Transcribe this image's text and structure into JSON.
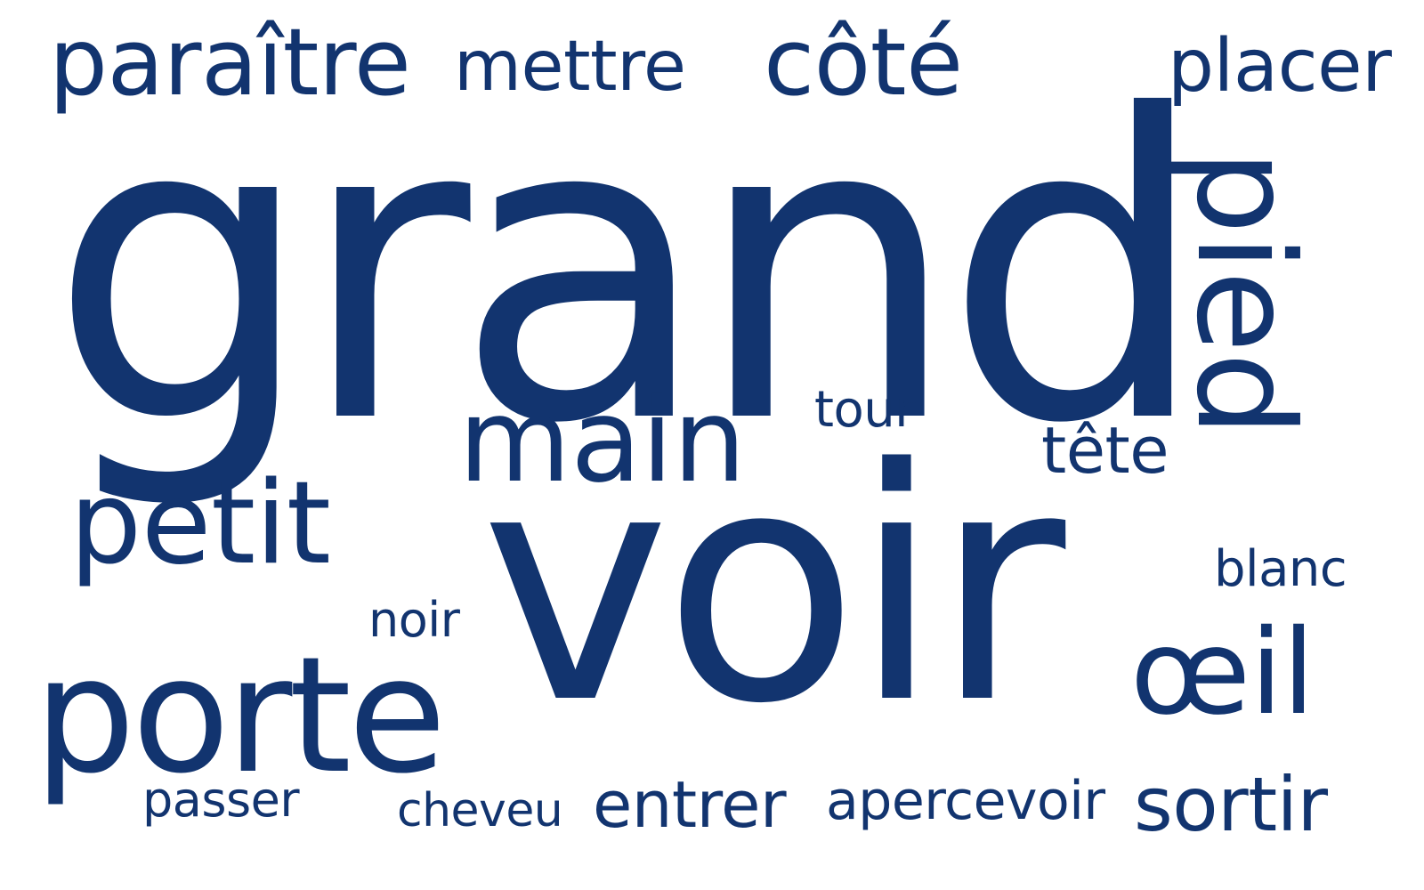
{
  "theme": {
    "text_color": "#12346F",
    "background": "#FFFFFF"
  },
  "words": {
    "paraitre": "paraître",
    "mettre": "mettre",
    "cote": "côté",
    "placer": "placer",
    "grand": "grand",
    "pied": "pied",
    "main": "main",
    "tour": "tour",
    "tete": "tête",
    "petit": "petit",
    "blanc": "blanc",
    "noir": "noir",
    "voir": "voir",
    "oeil": "œil",
    "porte": "porte",
    "passer": "passer",
    "cheveu": "cheveu",
    "entrer": "entrer",
    "apercevoir": "apercevoir",
    "sortir": "sortir"
  }
}
